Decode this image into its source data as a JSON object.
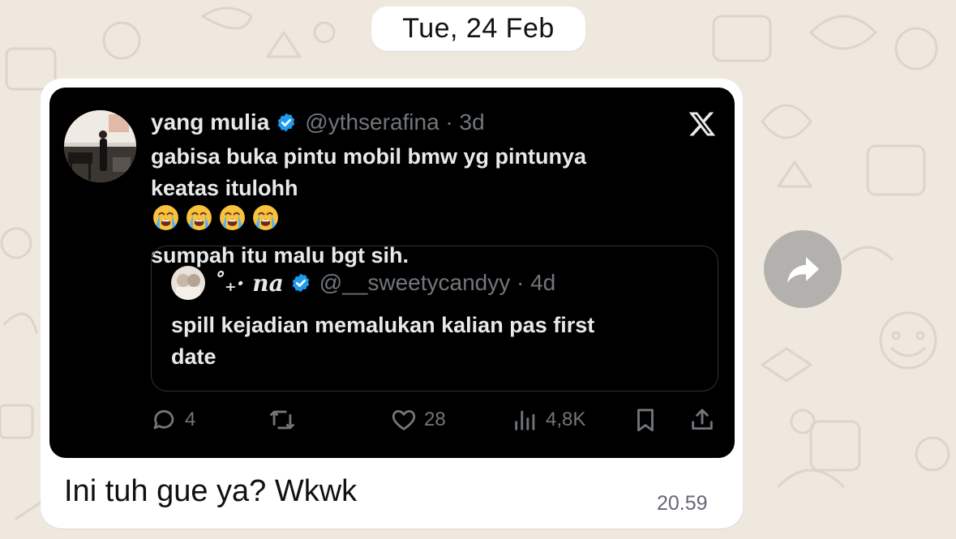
{
  "date_separator": "Tue, 24 Feb",
  "tweet": {
    "display_name": "yang mulia",
    "meta": "@ythserafina · 3d",
    "line1": "gabisa buka pintu mobil bmw yg pintunya",
    "line2": "keatas itulohh",
    "line3": "sumpah itu malu bgt sih.",
    "emoji_count": 4,
    "quote": {
      "display_name": "˚₊· na",
      "meta": "@__sweetycandyy · 4d",
      "line1": "spill kejadian memalukan kalian pas first",
      "line2": "date"
    },
    "actions": {
      "replies": "4",
      "likes": "28",
      "views": "4,8K"
    }
  },
  "message": {
    "text": "Ini tuh gue ya? Wkwk",
    "time": "20.59"
  },
  "colors": {
    "background": "#efe8df",
    "bubble": "#ffffff",
    "tweet_bg": "#000000",
    "verified_blue": "#1d9bf0",
    "muted": "#71767b"
  },
  "icons": [
    "verified-badge-icon",
    "x-logo-icon",
    "reply-icon",
    "retweet-icon",
    "like-icon",
    "views-icon",
    "bookmark-icon",
    "share-icon",
    "forward-icon"
  ]
}
